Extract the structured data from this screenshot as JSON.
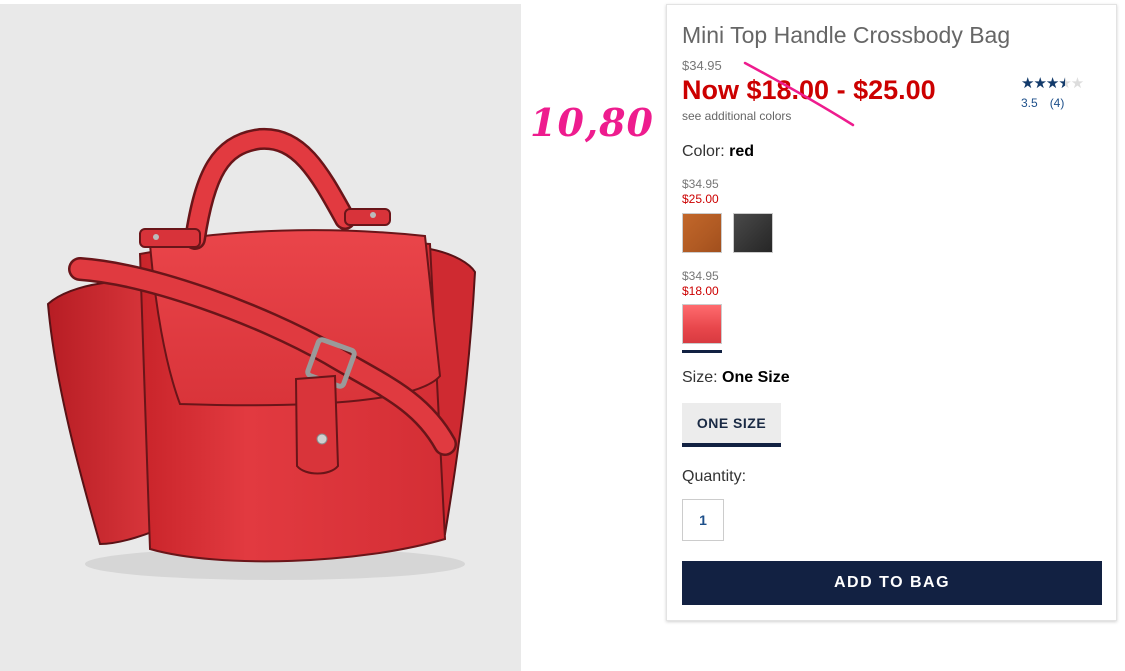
{
  "annotation": {
    "text": "10,80",
    "color": "#ee1c8e"
  },
  "product": {
    "title": "Mini Top Handle Crossbody Bag",
    "original_price": "$34.95",
    "sale_price": "Now $18.00 - $25.00",
    "see_colors": "see additional colors",
    "rating": {
      "value": 3.5,
      "value_text": "3.5",
      "max": 5,
      "count_text": "(4)"
    }
  },
  "color": {
    "label": "Color:",
    "selected": "red"
  },
  "price_groups": [
    {
      "original": "$34.95",
      "sale": "$25.00",
      "swatches": [
        {
          "name": "cognac",
          "color": "#b85f26"
        },
        {
          "name": "black",
          "color": "#333333"
        }
      ]
    },
    {
      "original": "$34.95",
      "sale": "$18.00",
      "swatches": [
        {
          "name": "red",
          "color": "#e8474c",
          "selected": true
        }
      ]
    }
  ],
  "size": {
    "label": "Size:",
    "selected": "One Size",
    "option": "ONE SIZE"
  },
  "quantity": {
    "label": "Quantity:",
    "value": "1"
  },
  "add_button": "ADD TO BAG",
  "colors": {
    "sale_red": "#cc0000",
    "navy": "#122142",
    "bag_red": "#e0343a"
  }
}
